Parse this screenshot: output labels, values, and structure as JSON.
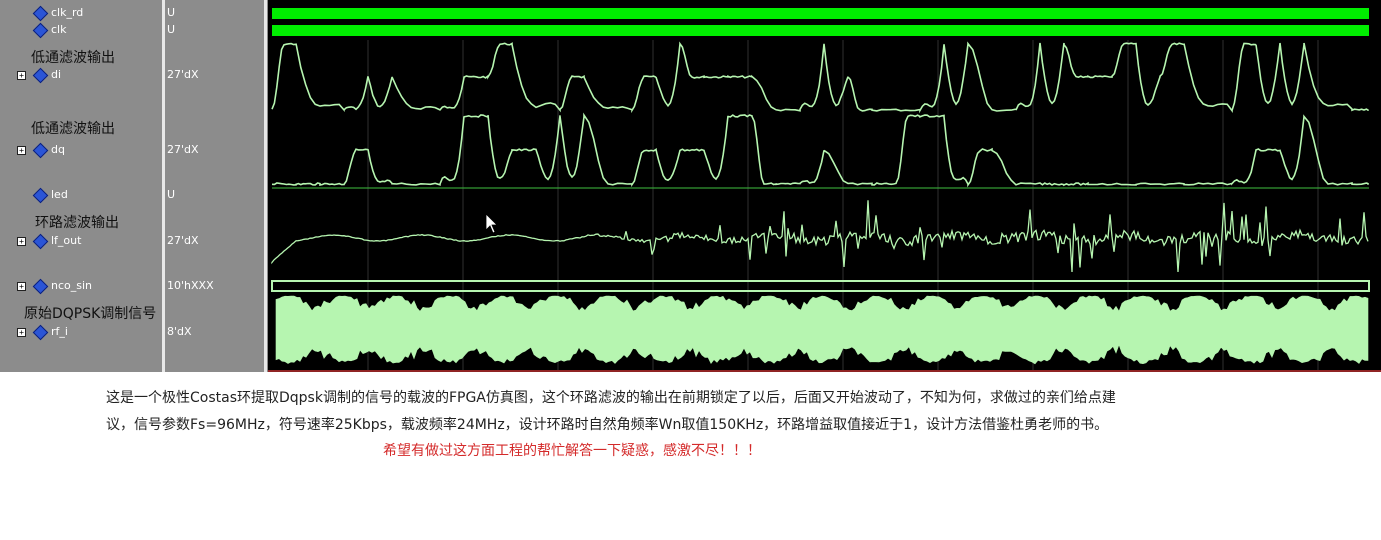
{
  "signals": [
    {
      "name": "clk_rd",
      "value": "U",
      "expandable": false,
      "icon": "signal-diamond-icon"
    },
    {
      "name": "clk",
      "value": "U",
      "expandable": false,
      "icon": "signal-diamond-icon"
    },
    {
      "name": "di",
      "value": "27'dX",
      "expandable": true,
      "icon": "signal-diamond-icon"
    },
    {
      "name": "dq",
      "value": "27'dX",
      "expandable": true,
      "icon": "signal-diamond-icon"
    },
    {
      "name": "led",
      "value": "U",
      "expandable": false,
      "icon": "signal-diamond-icon"
    },
    {
      "name": "lf_out",
      "value": "27'dX",
      "expandable": true,
      "icon": "signal-diamond-icon"
    },
    {
      "name": "nco_sin",
      "value": "10'hXXX",
      "expandable": true,
      "icon": "signal-diamond-icon"
    },
    {
      "name": "rf_i",
      "value": "8'dX",
      "expandable": true,
      "icon": "signal-diamond-icon"
    }
  ],
  "dividers": {
    "di": "低通滤波输出",
    "dq": "低通滤波输出",
    "lf_out": "环路滤波输出",
    "rf_i": "原始DQPSK调制信号"
  },
  "expand_glyph": "+",
  "colors": {
    "wave": "#b6f5b0",
    "clock_bar": "#00ee00",
    "background": "#000000",
    "grid": "#2f2f2f",
    "note_red": "#d42a2a"
  },
  "notes": {
    "line1": "这是一个极性Costas环提取Dqpsk调制的信号的载波的FPGA仿真图，这个环路滤波的输出在前期锁定了以后，后面又开始波动了，不知为何，求做过的亲们给点建",
    "line2": "议，信号参数Fs=96MHz，符号速率25Kbps，载波频率24MHz，设计环路时自然角频率Wn取值150KHz，环路增益取值接近于1，设计方法借鉴杜勇老师的书。",
    "line3": "希望有做过这方面工程的帮忙解答一下疑惑，感激不尽！！！"
  }
}
